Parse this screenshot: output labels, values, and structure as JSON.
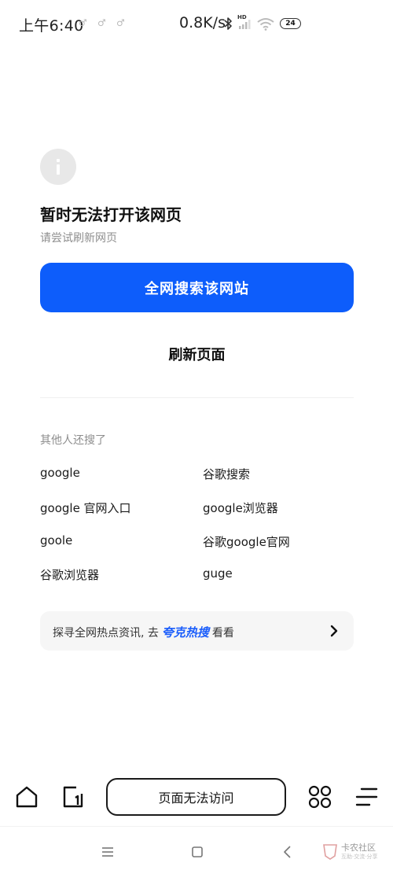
{
  "status_bar": {
    "time": "上午6:40",
    "speed": "0.8K/s",
    "hd_label": "HD",
    "battery": "24"
  },
  "error": {
    "title": "暂时无法打开该网页",
    "subtitle": "请尝试刷新网页",
    "search_button": "全网搜索该网站",
    "refresh_button": "刷新页面"
  },
  "others": {
    "label": "其他人还搜了",
    "items": [
      "google",
      "谷歌搜索",
      "google 官网入口",
      "google浏览器",
      "goole",
      "谷歌google官网",
      "谷歌浏览器",
      "guge"
    ]
  },
  "hot_bar": {
    "prefix": "探寻全网热点资讯, 去",
    "brand": "夸克热搜",
    "suffix": "看看"
  },
  "toolbar": {
    "url_text": "页面无法访问"
  },
  "watermark": {
    "text": "卡农社区",
    "sub": "互助·交流·分享"
  },
  "colors": {
    "primary": "#0d5dfb",
    "brand": "#1a5dfb"
  },
  "icons": {
    "home": "home-icon",
    "tabs": "tab-switch-icon",
    "grid": "apps-grid-icon",
    "menu": "menu-icon"
  }
}
